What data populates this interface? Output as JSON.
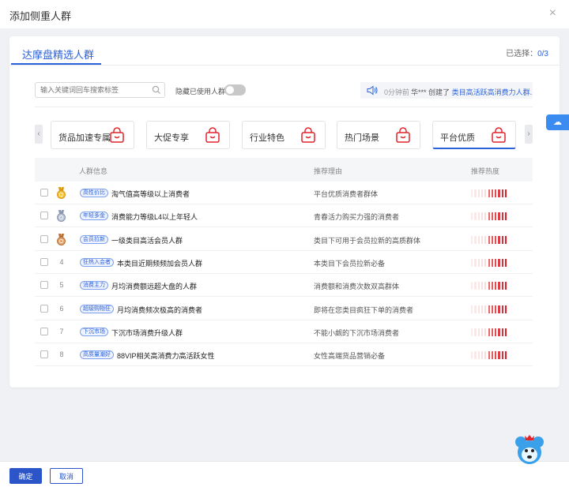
{
  "modal": {
    "title": "添加侧重人群",
    "close_symbol": "×"
  },
  "tabs": [
    {
      "label": "达摩盘精选人群",
      "active": true
    }
  ],
  "selection": {
    "label": "已选择：",
    "count": "0/3"
  },
  "search": {
    "placeholder": "输入关键词回车搜索标签"
  },
  "toggle": {
    "label": "隐藏已使用人群",
    "on": false
  },
  "notice": {
    "time": "0分钟前",
    "user": "华***",
    "action": "创建了",
    "link": "类目高活跃高消费力人群..."
  },
  "categories": [
    {
      "label": "货品加速专属",
      "active": false
    },
    {
      "label": "大促专享",
      "active": false
    },
    {
      "label": "行业特色",
      "active": false
    },
    {
      "label": "热门场景",
      "active": false
    },
    {
      "label": "平台优质",
      "active": true
    }
  ],
  "table": {
    "headers": {
      "info": "人群信息",
      "reason": "推荐理由",
      "heat": "推荐热度"
    },
    "rows": [
      {
        "rank": "1",
        "medal": "gold",
        "tag": "高性价比",
        "name": "淘气值高等级以上消费者",
        "reason": "平台优质消费者群体",
        "heat": 1
      },
      {
        "rank": "2",
        "medal": "silver",
        "tag": "年轻多金",
        "name": "消费能力等级L4以上年轻人",
        "reason": "青春活力购买力强的消费者",
        "heat": 1
      },
      {
        "rank": "3",
        "medal": "bronze",
        "tag": "会员拉新",
        "name": "一级类目高活会员人群",
        "reason": "类目下可用于会员拉新的高质群体",
        "heat": 1
      },
      {
        "rank": "4",
        "medal": "",
        "tag": "狂热入会者",
        "name": "本类目近期频频加会员人群",
        "reason": "本类目下会员拉新必备",
        "heat": 1
      },
      {
        "rank": "5",
        "medal": "",
        "tag": "消费主力",
        "name": "月均消费额远超大盘的人群",
        "reason": "消费额和消费次数双高群体",
        "heat": 1
      },
      {
        "rank": "6",
        "medal": "",
        "tag": "超级购物狂",
        "name": "月均消费频次极高的消费者",
        "reason": "即将在您类目疯狂下单的消费者",
        "heat": 1
      },
      {
        "rank": "7",
        "medal": "",
        "tag": "下沉市场",
        "name": "下沉市场消费升级人群",
        "reason": "不能小觑的下沉市场消费者",
        "heat": 1
      },
      {
        "rank": "8",
        "medal": "",
        "tag": "高质量潮好",
        "name": "88VIP相关高消费力高活跃女性",
        "reason": "女性高端货品营销必备",
        "heat": 1
      }
    ]
  },
  "footer": {
    "confirm": "确定",
    "cancel": "取消"
  },
  "colors": {
    "accent": "#2b62d9",
    "bag": "#e0242c",
    "heat_low": "#f6c6c6",
    "heat_high": "#d9232a"
  },
  "icons": {
    "search": "search-icon",
    "speaker": "speaker-icon",
    "bag": "shopping-bag-icon",
    "cloud": "cloud-icon",
    "mascot": "mascot-icon"
  }
}
